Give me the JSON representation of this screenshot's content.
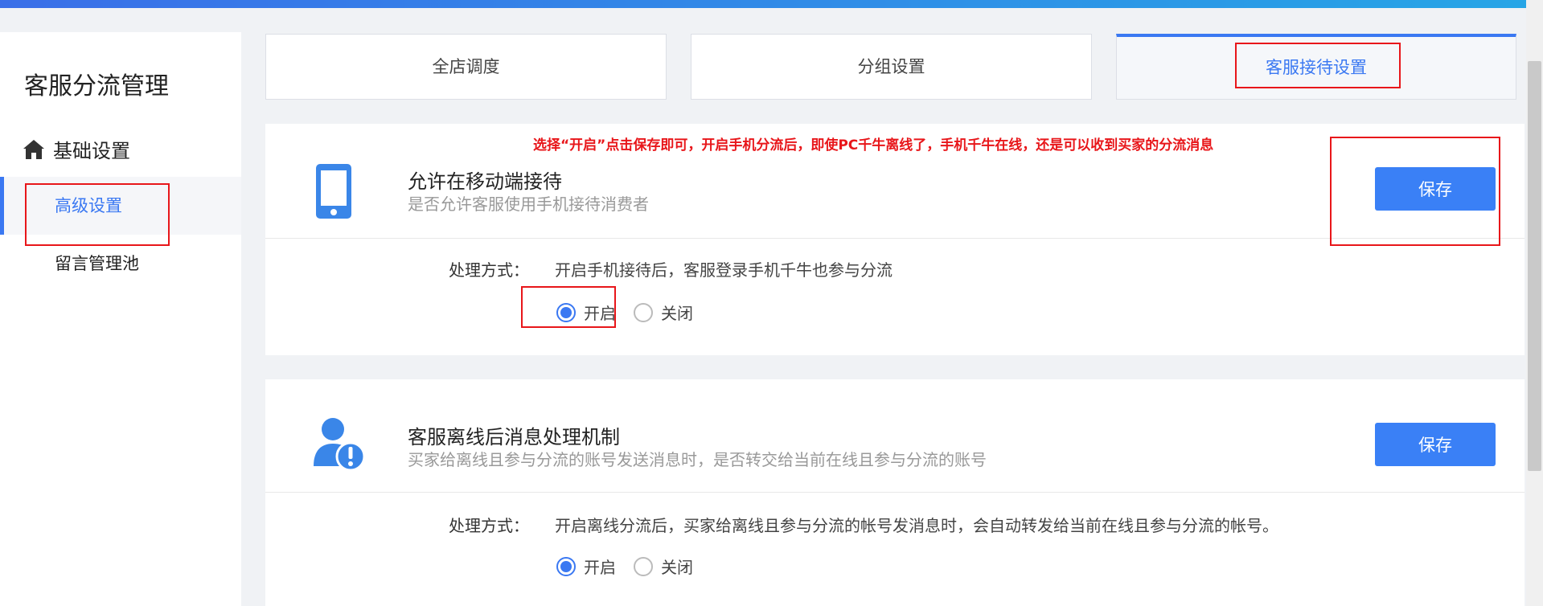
{
  "sidebar": {
    "title": "客服分流管理",
    "group_label": "基础设置",
    "items": [
      {
        "label": "高级设置",
        "active": true
      },
      {
        "label": "留言管理池",
        "active": false
      }
    ]
  },
  "tabs": [
    {
      "label": "全店调度",
      "active": false
    },
    {
      "label": "分组设置",
      "active": false
    },
    {
      "label": "客服接待设置",
      "active": true
    }
  ],
  "annotation_note": "选择“开启”点击保存即可，开启手机分流后，即使PC千牛离线了，手机千牛在线，还是可以收到买家的分流消息",
  "panels": [
    {
      "icon": "mobile-phone-icon",
      "title": "允许在移动端接待",
      "subtitle": "是否允许客服使用手机接待消费者",
      "save_label": "保存",
      "method_label": "处理方式：",
      "method_desc": "开启手机接待后，客服登录手机千牛也参与分流",
      "options": [
        {
          "label": "开启",
          "selected": true
        },
        {
          "label": "关闭",
          "selected": false
        }
      ]
    },
    {
      "icon": "user-warning-icon",
      "title": "客服离线后消息处理机制",
      "subtitle": "买家给离线且参与分流的账号发送消息时，是否转交给当前在线且参与分流的账号",
      "save_label": "保存",
      "method_label": "处理方式：",
      "method_desc": "开启离线分流后，买家给离线且参与分流的帐号发消息时，会自动转发给当前在线且参与分流的帐号。",
      "options": [
        {
          "label": "开启",
          "selected": true
        },
        {
          "label": "关闭",
          "selected": false
        }
      ]
    }
  ],
  "colors": {
    "accent": "#3a78f2",
    "annotation": "#e8161a",
    "button": "#3a80f6"
  }
}
